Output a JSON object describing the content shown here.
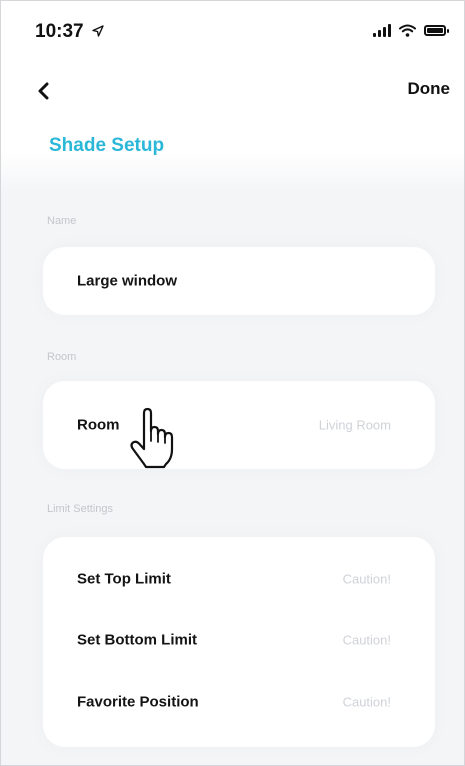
{
  "status_bar": {
    "time": "10:37"
  },
  "nav": {
    "done_label": "Done"
  },
  "page_title": "Shade Setup",
  "sections": {
    "name": {
      "label": "Name",
      "rows": [
        {
          "label": "Large window",
          "value": ""
        }
      ]
    },
    "room": {
      "label": "Room",
      "rows": [
        {
          "label": "Room",
          "value": "Living Room"
        }
      ]
    },
    "limit_settings": {
      "label": "Limit Settings",
      "rows": [
        {
          "label": "Set Top Limit",
          "value": "Caution!"
        },
        {
          "label": "Set Bottom Limit",
          "value": "Caution!"
        },
        {
          "label": "Favorite Position",
          "value": "Caution!"
        }
      ]
    }
  },
  "colors": {
    "accent": "#2bb7d8",
    "background": "#f4f5f7",
    "card": "#ffffff"
  },
  "icons": [
    "location-arrow-icon",
    "signal-icon",
    "wifi-icon",
    "battery-icon",
    "chevron-left-icon",
    "hand-pointer-icon"
  ]
}
